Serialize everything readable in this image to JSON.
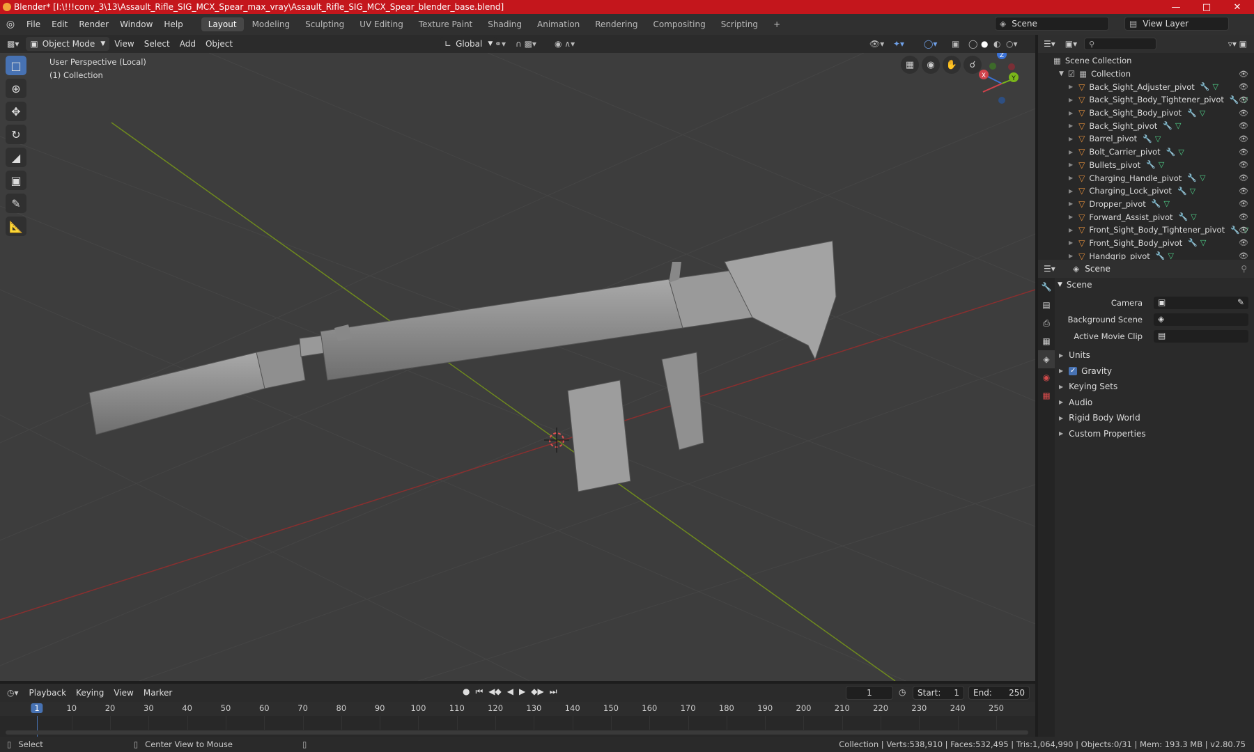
{
  "title": "Blender* [I:\\!!!conv_3\\13\\Assault_Rifle_SIG_MCX_Spear_max_vray\\Assault_Rifle_SIG_MCX_Spear_blender_base.blend]",
  "menu": [
    "File",
    "Edit",
    "Render",
    "Window",
    "Help"
  ],
  "workspaces": [
    "Layout",
    "Modeling",
    "Sculpting",
    "UV Editing",
    "Texture Paint",
    "Shading",
    "Animation",
    "Rendering",
    "Compositing",
    "Scripting"
  ],
  "active_workspace": "Layout",
  "scene_name": "Scene",
  "view_layer": "View Layer",
  "viewport_header": {
    "mode": "Object Mode",
    "menus": [
      "View",
      "Select",
      "Add",
      "Object"
    ],
    "transform": "Global"
  },
  "viewport_info": {
    "line1": "User Perspective (Local)",
    "line2": "(1) Collection"
  },
  "gizmo": {
    "x": "X",
    "y": "Y",
    "z": "Z"
  },
  "outliner": {
    "root": "Scene Collection",
    "collection": "Collection",
    "items": [
      "Back_Sight_Adjuster_pivot",
      "Back_Sight_Body_Tightener_pivot",
      "Back_Sight_Body_pivot",
      "Back_Sight_pivot",
      "Barrel_pivot",
      "Bolt_Carrier_pivot",
      "Bullets_pivot",
      "Charging_Handle_pivot",
      "Charging_Lock_pivot",
      "Dropper_pivot",
      "Forward_Assist_pivot",
      "Front_Sight_Body_Tightener_pivot",
      "Front_Sight_Body_pivot",
      "Handgrip_pivot"
    ]
  },
  "properties": {
    "header": "Scene",
    "panel": "Scene",
    "fields": [
      {
        "label": "Camera"
      },
      {
        "label": "Background Scene"
      },
      {
        "label": "Active Movie Clip"
      }
    ],
    "sections": [
      "Units",
      "Gravity",
      "Keying Sets",
      "Audio",
      "Rigid Body World",
      "Custom Properties"
    ]
  },
  "timeline": {
    "menus": [
      "Playback",
      "Keying",
      "View",
      "Marker"
    ],
    "current_frame": "1",
    "start_label": "Start:",
    "start": "1",
    "end_label": "End:",
    "end": "250",
    "ticks": [
      "1",
      "10",
      "20",
      "30",
      "40",
      "50",
      "60",
      "70",
      "80",
      "90",
      "100",
      "110",
      "120",
      "130",
      "140",
      "150",
      "160",
      "170",
      "180",
      "190",
      "200",
      "210",
      "220",
      "230",
      "240",
      "250"
    ]
  },
  "status": {
    "left": "Select",
    "mid": "Center View to Mouse",
    "right": "Collection | Verts:538,910 | Faces:532,495 | Tris:1,064,990 | Objects:0/31 | Mem: 193.3 MB | v2.80.75"
  },
  "colors": {
    "titlebar": "#c4161c",
    "accent": "#4772b3",
    "x_axis": "#a83232",
    "y_axis": "#6f8a1e"
  }
}
